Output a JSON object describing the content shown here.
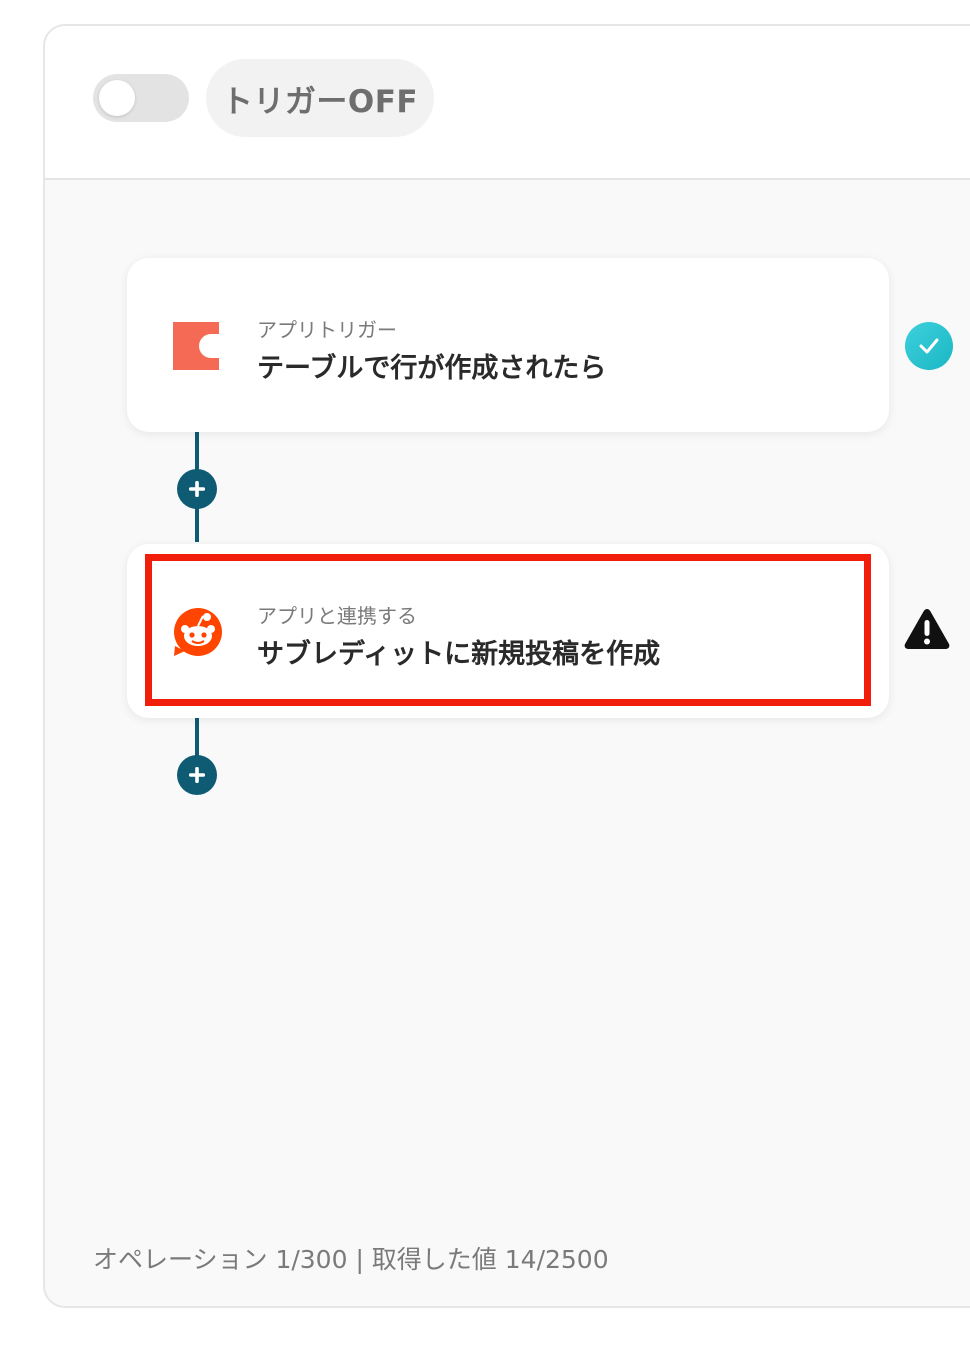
{
  "header": {
    "toggle_state": "off",
    "trigger_status_label": "トリガーOFF"
  },
  "flow": {
    "steps": [
      {
        "app_icon": "coda-icon",
        "subtitle": "アプリトリガー",
        "title": "テーブルで行が作成されたら",
        "status": "complete",
        "status_icon": "check-circle-icon"
      },
      {
        "app_icon": "reddit-icon",
        "subtitle": "アプリと連携する",
        "title": "サブレディットに新規投稿を作成",
        "status": "warning",
        "status_icon": "warning-triangle-icon",
        "highlighted": true
      }
    ]
  },
  "footer": {
    "stats": "オペレーション 1/300 | 取得した値 14/2500"
  },
  "colors": {
    "connector": "#0f5b73",
    "highlight": "#f01e0a",
    "check": "#1ab7c4",
    "coda_brand": "#f46a54",
    "reddit_brand": "#ff4500"
  }
}
